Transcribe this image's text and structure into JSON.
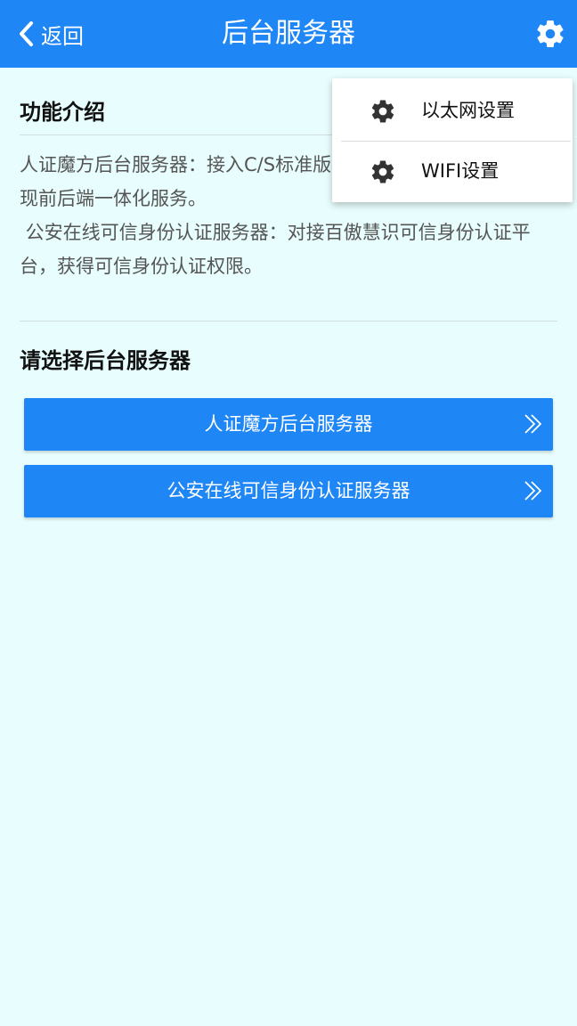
{
  "header": {
    "back_label": "返回",
    "title": "后台服务器"
  },
  "intro": {
    "heading": "功能介绍",
    "lines": [
      "人证魔方后台服务器：接入C/S标准版",
      "现前后端一体化服务。",
      " 公安在线可信身份认证服务器：对接百傲慧识可信身份认证平",
      "台，获得可信身份认证权限。"
    ]
  },
  "choose": {
    "heading": "请选择后台服务器",
    "buttons": [
      {
        "label": "人证魔方后台服务器",
        "icon": "double-chevron-right-icon"
      },
      {
        "label": "公安在线可信身份认证服务器",
        "icon": "double-chevron-right-icon"
      }
    ]
  },
  "menu": {
    "items": [
      {
        "label": "以太网设置",
        "icon": "gear-icon"
      },
      {
        "label": "WIFI设置",
        "icon": "gear-icon"
      }
    ]
  },
  "colors": {
    "primary": "#1e86f5",
    "background": "#e8fdfd",
    "menu_background": "#ffffff"
  }
}
